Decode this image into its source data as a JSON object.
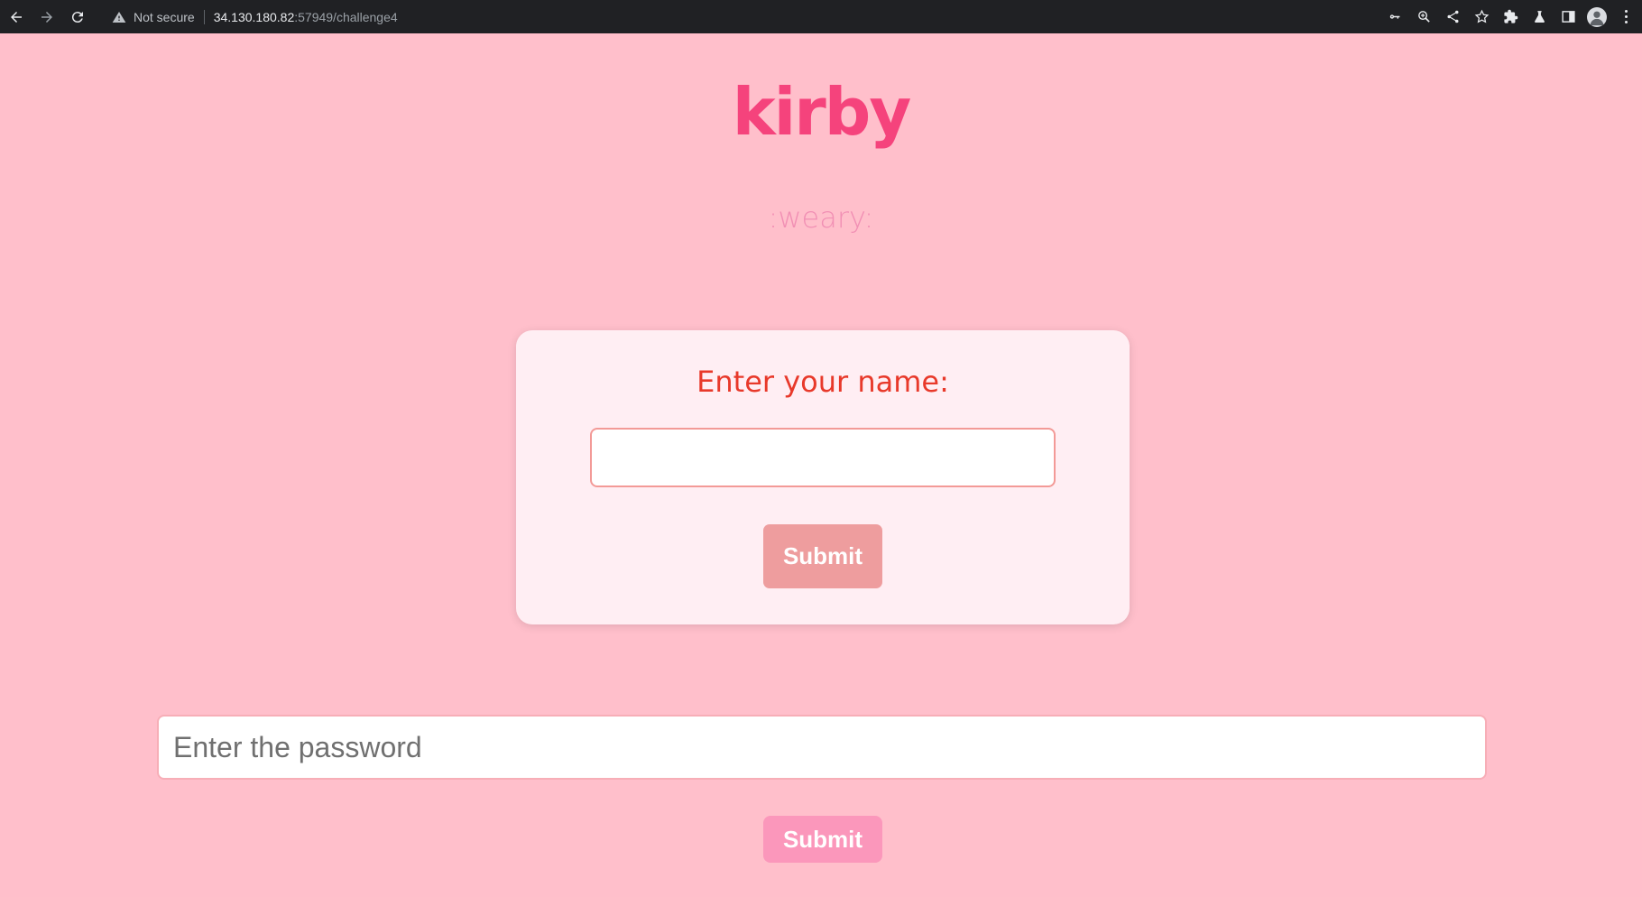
{
  "browser": {
    "security_label": "Not secure",
    "url_host": "34.130.180.82",
    "url_rest": ":57949/challenge4"
  },
  "page": {
    "brand": "kirby",
    "tagline": ":weary:"
  },
  "name_form": {
    "label": "Enter your name:",
    "input_value": "",
    "submit_label": "Submit"
  },
  "password_form": {
    "placeholder": "Enter the password",
    "submit_label": "Submit"
  },
  "colors": {
    "background": "#ffbfcb",
    "brand": "#f5437c",
    "card_label": "#e8392a"
  },
  "icons": [
    "back-icon",
    "forward-icon",
    "reload-icon",
    "warning-icon",
    "key-icon",
    "zoom-icon",
    "share-icon",
    "star-icon",
    "extensions-icon",
    "labs-icon",
    "side-panel-icon",
    "profile-icon",
    "menu-icon"
  ]
}
